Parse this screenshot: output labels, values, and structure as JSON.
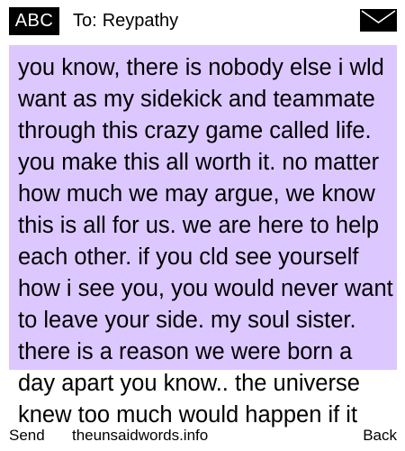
{
  "header": {
    "mode_label": "ABC",
    "to_label": "To:",
    "recipient": "Reypathy",
    "icon": "envelope-icon"
  },
  "message": {
    "text": "you know, there is nobody else i wld want as my sidekick and teammate through this crazy game called life. you make this all worth it. no matter how much we may argue, we know this is all for us. we are here to help each other. if you cld see yourself how i see you, you would never want to leave your side. my soul sister. there is a reason we were born a day apart you know.. the universe knew too much would happen if it"
  },
  "softkeys": {
    "left": "Send",
    "center": "theunsaidwords.info",
    "right": "Back"
  },
  "colors": {
    "message_background": "#dcc8ff",
    "badge_background": "#000000",
    "text": "#000000"
  }
}
